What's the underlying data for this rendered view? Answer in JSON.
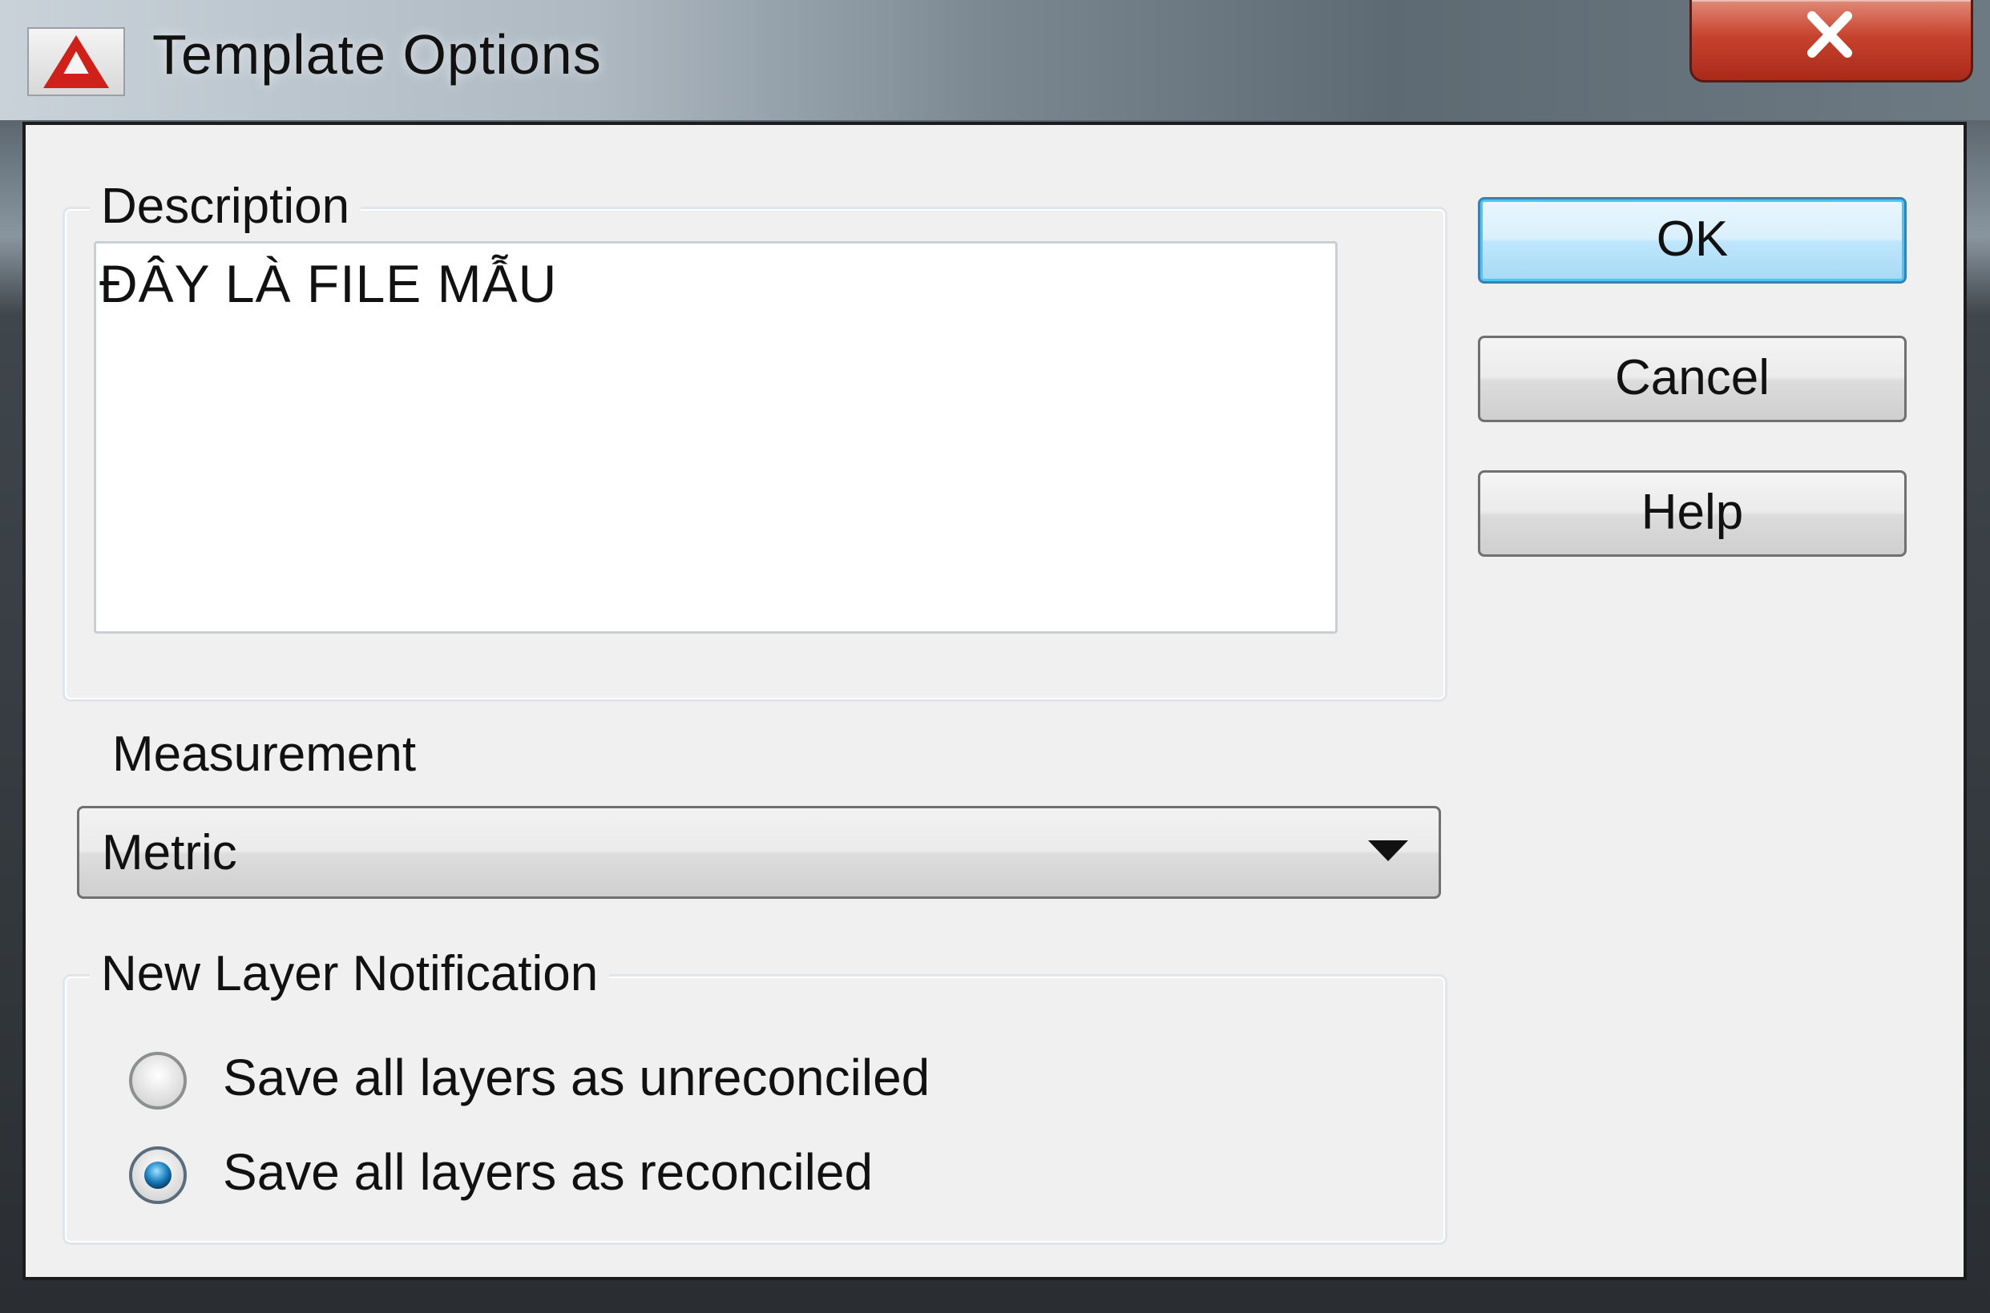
{
  "window": {
    "title": "Template Options",
    "close_label": "Close"
  },
  "description": {
    "group_label": "Description",
    "value": "ĐÂY LÀ FILE MẪU"
  },
  "buttons": {
    "ok": "OK",
    "cancel": "Cancel",
    "help": "Help"
  },
  "measurement": {
    "label": "Measurement",
    "selected": "Metric"
  },
  "new_layer_notification": {
    "group_label": "New Layer Notification",
    "options": [
      {
        "label": "Save all layers as unreconciled",
        "selected": false
      },
      {
        "label": "Save all layers as reconciled",
        "selected": true
      }
    ]
  },
  "icons": {
    "app": "autocad-logo-icon",
    "close": "close-icon",
    "dropdown": "chevron-down-icon",
    "radio_off": "radio-unchecked-icon",
    "radio_on": "radio-checked-icon"
  },
  "colors": {
    "close_button": "#c8432e",
    "default_button_glow": "#44c8f5",
    "app_icon_red": "#d0201a",
    "radio_dot": "#1a7fc0"
  }
}
